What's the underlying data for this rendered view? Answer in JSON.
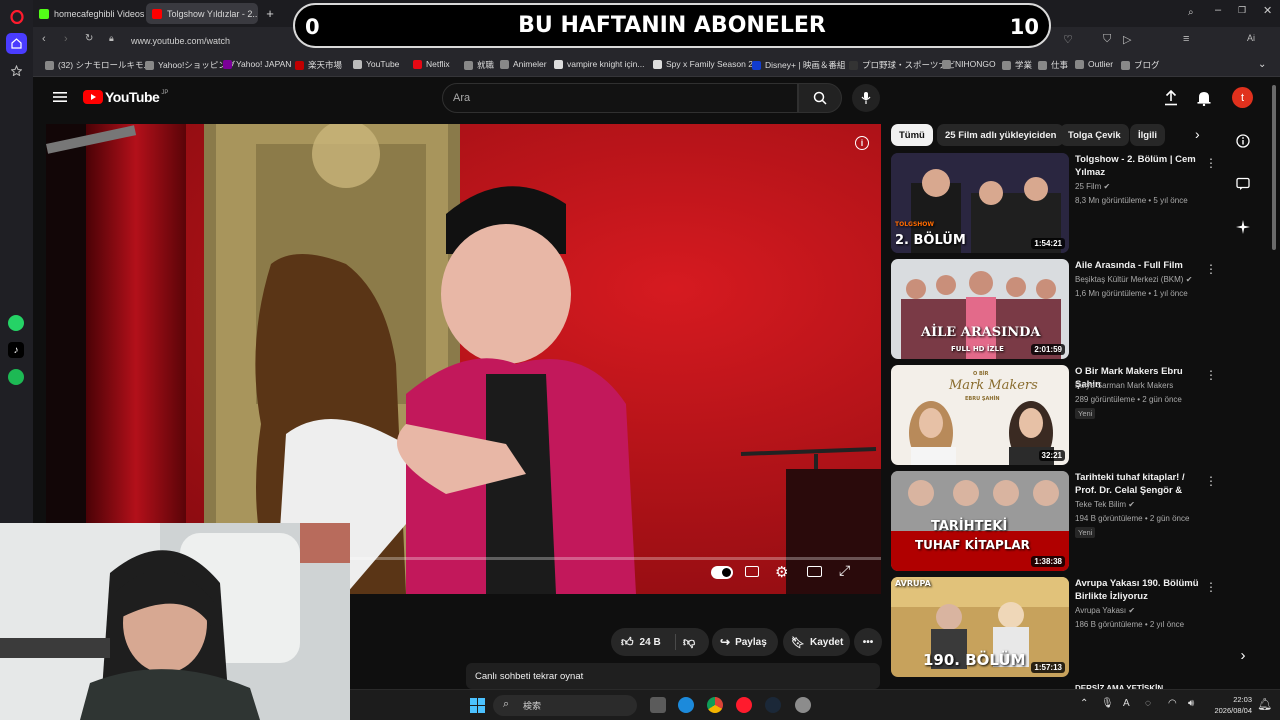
{
  "banner": {
    "left_count": "0",
    "title": "BU HAFTANIN ABONELER",
    "right_count": "10"
  },
  "tabs": [
    {
      "label": "homecafeghibli Videos - V"
    },
    {
      "label": "Tolgshow Yıldızlar - 2..."
    }
  ],
  "address": {
    "url": "www.youtube.com/watch"
  },
  "bookmarks": [
    "(32) シナモロールキモ...",
    "Yahoo!ショッピング",
    "Yahoo! JAPAN",
    "楽天市場",
    "YouTube",
    "Netflix",
    "就職",
    "Animeler",
    "vampire knight için...",
    "Spy x Family Season 2",
    "Disney+ | 映画＆番組",
    "プロ野球・スポーツナビ",
    "NIHONGO",
    "学業",
    "仕事",
    "Outlier",
    "ブログ"
  ],
  "youtube": {
    "logo_text": "YouTube",
    "logo_region": "JP",
    "search_placeholder": "Ara",
    "avatar_letter": "t"
  },
  "player": {
    "progress": 0.0
  },
  "actions": {
    "likes": "24 B",
    "share": "Paylaş",
    "save": "Kaydet",
    "chat_replay": "Canlı sohbeti tekrar oynat"
  },
  "chips": [
    "Tümü",
    "25 Film adlı yükleyiciden",
    "Tolga Çevik",
    "İlgili"
  ],
  "recommendations": [
    {
      "title": "Tolgshow - 2. Bölüm | Cem Yılmaz",
      "channel": "25 Film",
      "verified": true,
      "meta": "8,3 Mn görüntüleme • 5 yıl önce",
      "duration": "1:54:21",
      "thumb_caption": "2. BÖLÜM",
      "thumb_brand": "TOLGSHOW",
      "is_new": false
    },
    {
      "title": "Aile Arasında - Full Film",
      "channel": "Beşiktaş Kültür Merkezi (BKM)",
      "verified": true,
      "meta": "1,6 Mn görüntüleme • 1 yıl önce",
      "duration": "2:01:59",
      "thumb_caption": "AİLE ARASINDA",
      "thumb_sub": "FULL HD İZLE",
      "is_new": false
    },
    {
      "title": "O Bir Mark Makers Ebru Şahin",
      "channel": "Fulya Sarman Mark Makers",
      "verified": false,
      "meta": "289 görüntüleme • 2 gün önce",
      "duration": "32:21",
      "thumb_caption": "Mark Makers",
      "thumb_top": "O BİR",
      "thumb_sub": "EBRU ŞAHİN",
      "is_new": true
    },
    {
      "title": "Tarihteki tuhaf kitaplar! / Prof. Dr. Celal Şengör & Oğu...",
      "channel": "Teke Tek Bilim",
      "verified": true,
      "meta": "194 B görüntüleme • 2 gün önce",
      "duration": "1:38:38",
      "thumb_caption": "TARİHTEKİ",
      "thumb_sub": "TUHAF KİTAPLAR",
      "is_new": true
    },
    {
      "title": "Avrupa Yakası 190. Bölümü Birlikte İzliyoruz",
      "channel": "Avrupa Yakası",
      "verified": true,
      "meta": "186 B görüntüleme • 2 yıl önce",
      "duration": "1:57:13",
      "thumb_caption": "190. BÖLÜM",
      "thumb_top": "AVRUPA",
      "is_new": false
    }
  ],
  "new_badge": "Yeni",
  "next_rec_partial": "DERSİZ AMA YETİŞKİN",
  "taskbar": {
    "search_label": "検索",
    "time": "22:03",
    "date": "2026/08/04"
  },
  "colors": {
    "youtube_red": "#ff0000",
    "opera_red": "#ff1b2d",
    "background": "#0f0f0f"
  }
}
